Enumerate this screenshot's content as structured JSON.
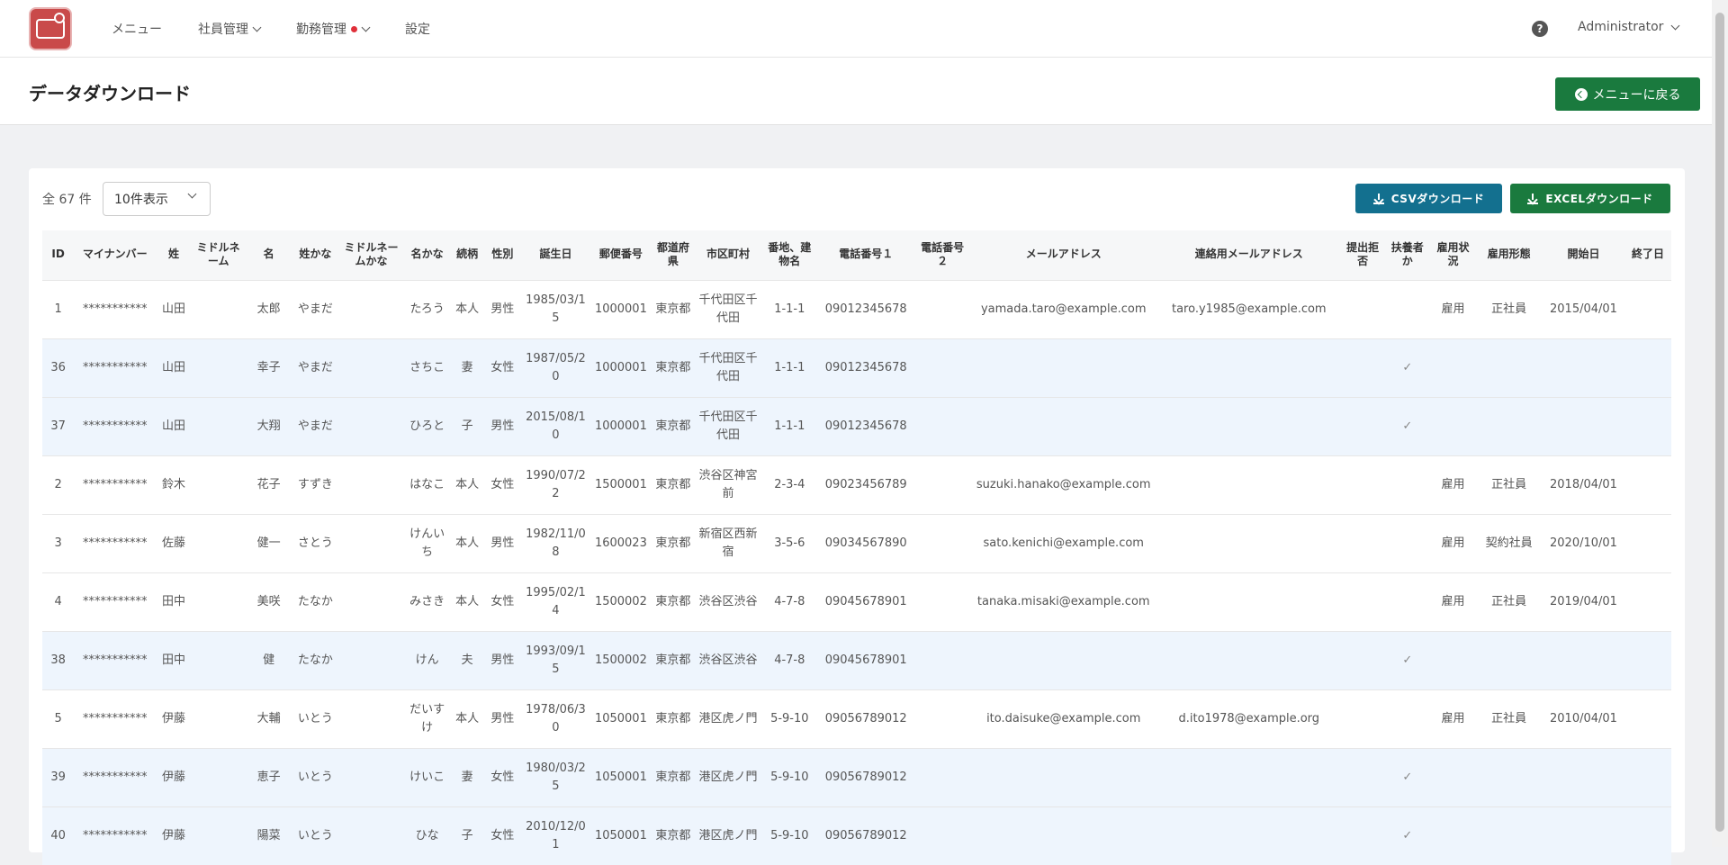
{
  "nav": {
    "menu": "メニュー",
    "employee": "社員管理",
    "attendance": "勤務管理",
    "settings": "設定",
    "user": "Administrator"
  },
  "page": {
    "title": "データダウンロード",
    "back_label": "メニューに戻る"
  },
  "toolbar": {
    "count": "全 67 件",
    "per_page": "10件表示",
    "csv_label": "CSVダウンロード",
    "excel_label": "EXCELダウンロード"
  },
  "table": {
    "headers": [
      "ID",
      "マイナンバー",
      "姓",
      "ミドルネーム",
      "名",
      "姓かな",
      "ミドルネームかな",
      "名かな",
      "続柄",
      "性別",
      "誕生日",
      "郵便番号",
      "都道府県",
      "市区町村",
      "番地、建物名",
      "電話番号１",
      "電話番号２",
      "メールアドレス",
      "連絡用メールアドレス",
      "提出拒否",
      "扶養者か",
      "雇用状況",
      "雇用形態",
      "開始日",
      "終了日"
    ],
    "rows": [
      [
        "1",
        "***********",
        "山田",
        "",
        "太郎",
        "やまだ",
        "",
        "たろう",
        "本人",
        "男性",
        "1985/03/15",
        "1000001",
        "東京都",
        "千代田区千代田",
        "1-1-1",
        "09012345678",
        "",
        "yamada.taro@example.com",
        "taro.y1985@example.com",
        "",
        "",
        "雇用",
        "正社員",
        "2015/04/01",
        ""
      ],
      [
        "36",
        "***********",
        "山田",
        "",
        "幸子",
        "やまだ",
        "",
        "さちこ",
        "妻",
        "女性",
        "1987/05/20",
        "1000001",
        "東京都",
        "千代田区千代田",
        "1-1-1",
        "09012345678",
        "",
        "",
        "",
        "",
        "✓",
        "",
        "",
        "",
        ""
      ],
      [
        "37",
        "***********",
        "山田",
        "",
        "大翔",
        "やまだ",
        "",
        "ひろと",
        "子",
        "男性",
        "2015/08/10",
        "1000001",
        "東京都",
        "千代田区千代田",
        "1-1-1",
        "09012345678",
        "",
        "",
        "",
        "",
        "✓",
        "",
        "",
        "",
        ""
      ],
      [
        "2",
        "***********",
        "鈴木",
        "",
        "花子",
        "すずき",
        "",
        "はなこ",
        "本人",
        "女性",
        "1990/07/22",
        "1500001",
        "東京都",
        "渋谷区神宮前",
        "2-3-4",
        "09023456789",
        "",
        "suzuki.hanako@example.com",
        "",
        "",
        "",
        "雇用",
        "正社員",
        "2018/04/01",
        ""
      ],
      [
        "3",
        "***********",
        "佐藤",
        "",
        "健一",
        "さとう",
        "",
        "けんいち",
        "本人",
        "男性",
        "1982/11/08",
        "1600023",
        "東京都",
        "新宿区西新宿",
        "3-5-6",
        "09034567890",
        "",
        "sato.kenichi@example.com",
        "",
        "",
        "",
        "雇用",
        "契約社員",
        "2020/10/01",
        ""
      ],
      [
        "4",
        "***********",
        "田中",
        "",
        "美咲",
        "たなか",
        "",
        "みさき",
        "本人",
        "女性",
        "1995/02/14",
        "1500002",
        "東京都",
        "渋谷区渋谷",
        "4-7-8",
        "09045678901",
        "",
        "tanaka.misaki@example.com",
        "",
        "",
        "",
        "雇用",
        "正社員",
        "2019/04/01",
        ""
      ],
      [
        "38",
        "***********",
        "田中",
        "",
        "健",
        "たなか",
        "",
        "けん",
        "夫",
        "男性",
        "1993/09/15",
        "1500002",
        "東京都",
        "渋谷区渋谷",
        "4-7-8",
        "09045678901",
        "",
        "",
        "",
        "",
        "✓",
        "",
        "",
        "",
        ""
      ],
      [
        "5",
        "***********",
        "伊藤",
        "",
        "大輔",
        "いとう",
        "",
        "だいすけ",
        "本人",
        "男性",
        "1978/06/30",
        "1050001",
        "東京都",
        "港区虎ノ門",
        "5-9-10",
        "09056789012",
        "",
        "ito.daisuke@example.com",
        "d.ito1978@example.org",
        "",
        "",
        "雇用",
        "正社員",
        "2010/04/01",
        ""
      ],
      [
        "39",
        "***********",
        "伊藤",
        "",
        "恵子",
        "いとう",
        "",
        "けいこ",
        "妻",
        "女性",
        "1980/03/25",
        "1050001",
        "東京都",
        "港区虎ノ門",
        "5-9-10",
        "09056789012",
        "",
        "",
        "",
        "",
        "✓",
        "",
        "",
        "",
        ""
      ],
      [
        "40",
        "***********",
        "伊藤",
        "",
        "陽菜",
        "いとう",
        "",
        "ひな",
        "子",
        "女性",
        "2010/12/01",
        "1050001",
        "東京都",
        "港区虎ノ門",
        "5-9-10",
        "09056789012",
        "",
        "",
        "",
        "",
        "✓",
        "",
        "",
        "",
        ""
      ]
    ],
    "alt_rows": [
      1,
      2,
      6,
      8,
      9
    ]
  },
  "icons": {
    "logo": "camera-lock-logo-icon",
    "help": "question-circle-icon",
    "back": "arrow-left-circle-icon",
    "download": "download-icon",
    "check": "check-icon"
  },
  "colors": {
    "green": "#1a7a3e",
    "teal": "#13708f",
    "logo": "#c94a4a",
    "alt_row": "#eef5fd"
  }
}
